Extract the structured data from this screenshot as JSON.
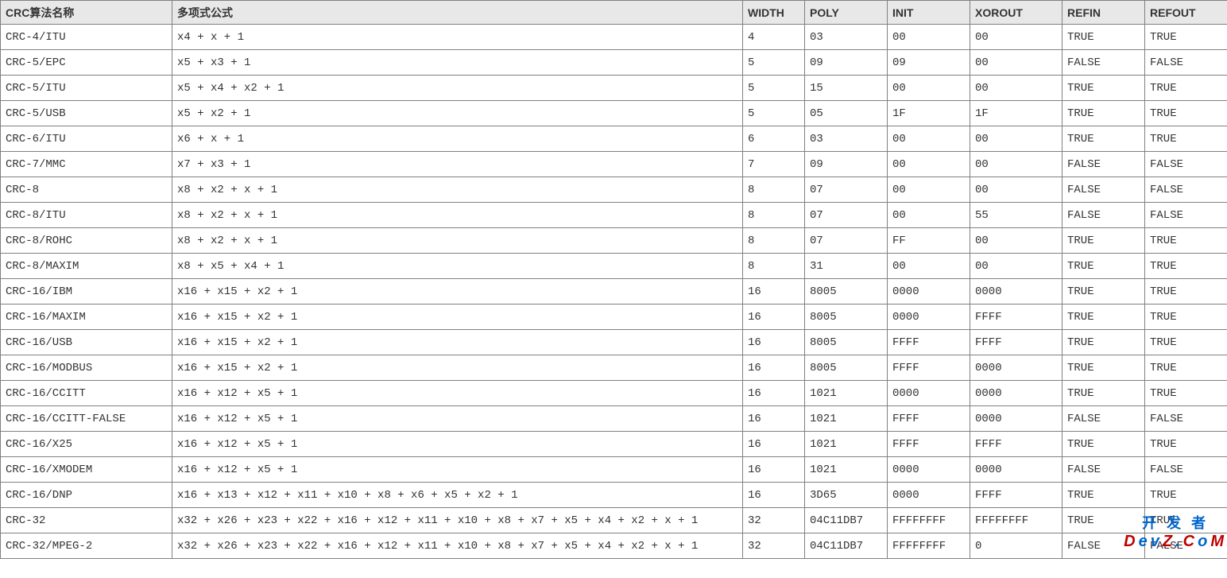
{
  "headers": {
    "name": "CRC算法名称",
    "formula": "多项式公式",
    "width": "WIDTH",
    "poly": "POLY",
    "init": "INIT",
    "xorout": "XOROUT",
    "refin": "REFIN",
    "refout": "REFOUT"
  },
  "rows": [
    {
      "name": "CRC-4/ITU",
      "formula": "x4 + x + 1",
      "width": "4",
      "poly": "03",
      "init": "00",
      "xorout": "00",
      "refin": "TRUE",
      "refout": "TRUE"
    },
    {
      "name": "CRC-5/EPC",
      "formula": "x5 + x3 + 1",
      "width": "5",
      "poly": "09",
      "init": "09",
      "xorout": "00",
      "refin": "FALSE",
      "refout": "FALSE"
    },
    {
      "name": "CRC-5/ITU",
      "formula": "x5 + x4 + x2 + 1",
      "width": "5",
      "poly": "15",
      "init": "00",
      "xorout": "00",
      "refin": "TRUE",
      "refout": "TRUE"
    },
    {
      "name": "CRC-5/USB",
      "formula": "x5 + x2 + 1",
      "width": "5",
      "poly": "05",
      "init": "1F",
      "xorout": "1F",
      "refin": "TRUE",
      "refout": "TRUE"
    },
    {
      "name": "CRC-6/ITU",
      "formula": "x6 + x + 1",
      "width": "6",
      "poly": "03",
      "init": "00",
      "xorout": "00",
      "refin": "TRUE",
      "refout": "TRUE"
    },
    {
      "name": "CRC-7/MMC",
      "formula": "x7 + x3 + 1",
      "width": "7",
      "poly": "09",
      "init": "00",
      "xorout": "00",
      "refin": "FALSE",
      "refout": "FALSE"
    },
    {
      "name": "CRC-8",
      "formula": "x8 + x2 + x + 1",
      "width": "8",
      "poly": "07",
      "init": "00",
      "xorout": "00",
      "refin": "FALSE",
      "refout": "FALSE"
    },
    {
      "name": "CRC-8/ITU",
      "formula": "x8 + x2 + x + 1",
      "width": "8",
      "poly": "07",
      "init": "00",
      "xorout": "55",
      "refin": "FALSE",
      "refout": "FALSE"
    },
    {
      "name": "CRC-8/ROHC",
      "formula": "x8 + x2 + x + 1",
      "width": "8",
      "poly": "07",
      "init": "FF",
      "xorout": "00",
      "refin": "TRUE",
      "refout": "TRUE"
    },
    {
      "name": "CRC-8/MAXIM",
      "formula": "x8 + x5 + x4 + 1",
      "width": "8",
      "poly": "31",
      "init": "00",
      "xorout": "00",
      "refin": "TRUE",
      "refout": "TRUE"
    },
    {
      "name": "CRC-16/IBM",
      "formula": "x16 + x15 + x2 + 1",
      "width": "16",
      "poly": "8005",
      "init": "0000",
      "xorout": "0000",
      "refin": "TRUE",
      "refout": "TRUE"
    },
    {
      "name": "CRC-16/MAXIM",
      "formula": "x16 + x15 + x2 + 1",
      "width": "16",
      "poly": "8005",
      "init": "0000",
      "xorout": "FFFF",
      "refin": "TRUE",
      "refout": "TRUE"
    },
    {
      "name": "CRC-16/USB",
      "formula": "x16 + x15 + x2 + 1",
      "width": "16",
      "poly": "8005",
      "init": "FFFF",
      "xorout": "FFFF",
      "refin": "TRUE",
      "refout": "TRUE"
    },
    {
      "name": "CRC-16/MODBUS",
      "formula": "x16 + x15 + x2 + 1",
      "width": "16",
      "poly": "8005",
      "init": "FFFF",
      "xorout": "0000",
      "refin": "TRUE",
      "refout": "TRUE"
    },
    {
      "name": "CRC-16/CCITT",
      "formula": "x16 + x12 + x5 + 1",
      "width": "16",
      "poly": "1021",
      "init": "0000",
      "xorout": "0000",
      "refin": "TRUE",
      "refout": "TRUE"
    },
    {
      "name": "CRC-16/CCITT-FALSE",
      "formula": "x16 + x12 + x5 + 1",
      "width": "16",
      "poly": "1021",
      "init": "FFFF",
      "xorout": "0000",
      "refin": "FALSE",
      "refout": "FALSE"
    },
    {
      "name": "CRC-16/X25",
      "formula": "x16 + x12 + x5 + 1",
      "width": "16",
      "poly": "1021",
      "init": "FFFF",
      "xorout": "FFFF",
      "refin": "TRUE",
      "refout": "TRUE"
    },
    {
      "name": "CRC-16/XMODEM",
      "formula": "x16 + x12 + x5 + 1",
      "width": "16",
      "poly": "1021",
      "init": "0000",
      "xorout": "0000",
      "refin": "FALSE",
      "refout": "FALSE"
    },
    {
      "name": "CRC-16/DNP",
      "formula": "x16 + x13 + x12 + x11 + x10 + x8 + x6 + x5 + x2 + 1",
      "width": "16",
      "poly": "3D65",
      "init": "0000",
      "xorout": "FFFF",
      "refin": "TRUE",
      "refout": "TRUE"
    },
    {
      "name": "CRC-32",
      "formula": "x32 + x26 + x23 + x22 + x16 + x12 + x11 + x10 + x8 + x7 + x5 + x4 + x2 + x + 1",
      "width": "32",
      "poly": "04C11DB7",
      "init": "FFFFFFFF",
      "xorout": "FFFFFFFF",
      "refin": "TRUE",
      "refout": "TRUE"
    },
    {
      "name": "CRC-32/MPEG-2",
      "formula": "x32 + x26 + x23 + x22 + x16 + x12 + x11 + x10 + x8 + x7 + x5 + x4 + x2 + x + 1",
      "width": "32",
      "poly": "04C11DB7",
      "init": "FFFFFFFF",
      "xorout": "0",
      "refin": "FALSE",
      "refout": "FALSE"
    }
  ],
  "watermark": {
    "cn": "开 发 者",
    "en_prefix": "D",
    "en_mid1": "e",
    "en_mid2": "v",
    "en_mid3": "Z",
    "en_dot": ".",
    "en_c": "C",
    "en_o": "o",
    "en_m": "M"
  }
}
